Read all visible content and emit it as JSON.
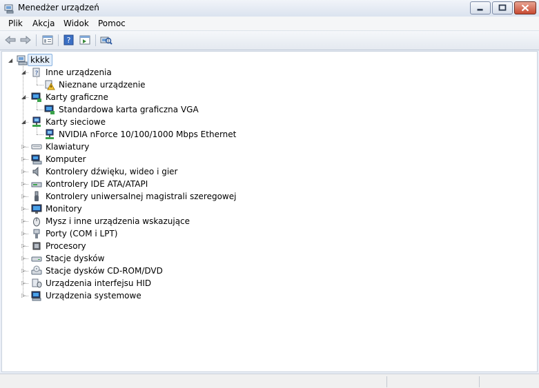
{
  "window": {
    "title": "Menedżer urządzeń"
  },
  "menubar": {
    "items": [
      "Plik",
      "Akcja",
      "Widok",
      "Pomoc"
    ]
  },
  "toolbar": {
    "buttons": [
      "back-arrow-icon",
      "forward-arrow-icon",
      "properties-icon",
      "help-icon",
      "view-icon",
      "scan-hardware-icon"
    ]
  },
  "tree": {
    "root": "kkkk",
    "nodes": [
      {
        "label": "Inne urządzenia",
        "expanded": true,
        "icon": "unknown-device-icon"
      },
      {
        "label": "Nieznane urządzenie",
        "child": true,
        "icon": "warning-device-icon"
      },
      {
        "label": "Karty graficzne",
        "expanded": true,
        "icon": "display-adapter-icon"
      },
      {
        "label": "Standardowa karta graficzna VGA",
        "child": true,
        "icon": "display-adapter-icon"
      },
      {
        "label": "Karty sieciowe",
        "expanded": true,
        "icon": "network-adapter-icon"
      },
      {
        "label": "NVIDIA nForce 10/100/1000 Mbps Ethernet",
        "child": true,
        "icon": "network-adapter-icon"
      },
      {
        "label": "Klawiatury",
        "expanded": false,
        "icon": "keyboard-icon"
      },
      {
        "label": "Komputer",
        "expanded": false,
        "icon": "computer-icon"
      },
      {
        "label": "Kontrolery dźwięku, wideo i gier",
        "expanded": false,
        "icon": "speaker-icon"
      },
      {
        "label": "Kontrolery IDE ATA/ATAPI",
        "expanded": false,
        "icon": "ide-controller-icon"
      },
      {
        "label": "Kontrolery uniwersalnej magistrali szeregowej",
        "expanded": false,
        "icon": "usb-icon"
      },
      {
        "label": "Monitory",
        "expanded": false,
        "icon": "monitor-icon"
      },
      {
        "label": "Mysz i inne urządzenia wskazujące",
        "expanded": false,
        "icon": "mouse-icon"
      },
      {
        "label": "Porty (COM i LPT)",
        "expanded": false,
        "icon": "port-icon"
      },
      {
        "label": "Procesory",
        "expanded": false,
        "icon": "processor-icon"
      },
      {
        "label": "Stacje dysków",
        "expanded": false,
        "icon": "disk-drive-icon"
      },
      {
        "label": "Stacje dysków CD-ROM/DVD",
        "expanded": false,
        "icon": "cdrom-icon"
      },
      {
        "label": "Urządzenia interfejsu HID",
        "expanded": false,
        "icon": "hid-icon"
      },
      {
        "label": "Urządzenia systemowe",
        "expanded": false,
        "icon": "system-device-icon"
      }
    ]
  }
}
